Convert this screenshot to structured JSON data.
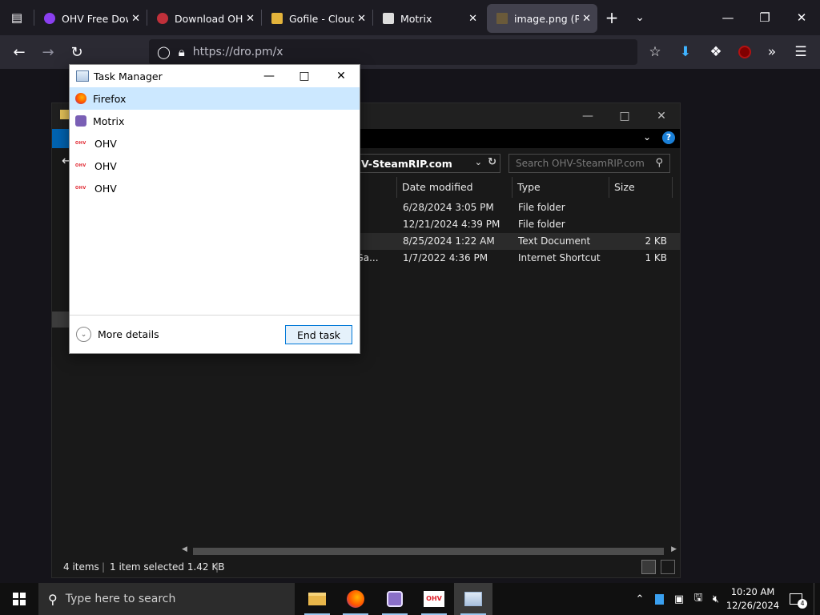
{
  "browser": {
    "tabs": [
      {
        "title": "OHV Free Down",
        "favicon_color": "#8a3ff0"
      },
      {
        "title": "Download OHV",
        "favicon_color": "#c0303a"
      },
      {
        "title": "Gofile - Cloud S",
        "favicon_color": "#e3b33b"
      },
      {
        "title": "Motrix",
        "favicon_color": "#dddddd"
      },
      {
        "title": "image.png (PN",
        "favicon_color": "#6a5a3a"
      }
    ],
    "url": "https://dro.pm/x"
  },
  "task_manager": {
    "title": "Task Manager",
    "apps": [
      {
        "name": "Firefox",
        "icon": "firefox-icon"
      },
      {
        "name": "Motrix",
        "icon": "motrix-icon"
      },
      {
        "name": "OHV",
        "icon": "ohv-icon"
      },
      {
        "name": "OHV",
        "icon": "ohv-icon"
      },
      {
        "name": "OHV",
        "icon": "ohv-icon"
      }
    ],
    "ohv_icon_text": "OHV",
    "more_details": "More details",
    "end_task": "End task"
  },
  "explorer": {
    "path": "V-SteamRIP.com",
    "search_placeholder": "Search OHV-SteamRIP.com",
    "columns": [
      "Date modified",
      "Type",
      "Size"
    ],
    "rows": [
      {
        "name": "",
        "date": "6/28/2024 3:05 PM",
        "type": "File folder",
        "size": ""
      },
      {
        "name": "",
        "date": "12/21/2024 4:39 PM",
        "type": "File folder",
        "size": ""
      },
      {
        "name": "",
        "date": "8/25/2024 1:22 AM",
        "type": "Text Document",
        "size": "2 KB"
      },
      {
        "name": "n Ga...",
        "date": "1/7/2022 4:36 PM",
        "type": "Internet Shortcut",
        "size": "1 KB"
      }
    ],
    "status": {
      "items": "4 items",
      "selected": "1 item selected  1.42 KB"
    }
  },
  "taskbar": {
    "search_placeholder": "Type here to search",
    "ohv_label": "OHV",
    "time": "10:20 AM",
    "date": "12/26/2024",
    "notification_count": "4"
  },
  "colors": {
    "accent": "#0078d7",
    "selection": "#cce8ff",
    "firefox_bg": "#1c1b22"
  }
}
